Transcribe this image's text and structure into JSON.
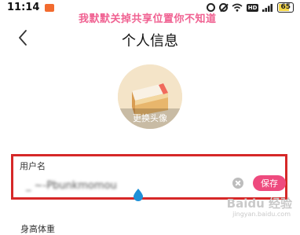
{
  "status_bar": {
    "time": "11:14",
    "battery": "65",
    "notification_icon": "app-notification-icon",
    "icons": [
      "alarm-icon",
      "mute-icon",
      "wifi-icon",
      "hd-icon",
      "signal-icon",
      "battery-icon"
    ]
  },
  "watermark": {
    "top_text": "我默默关掉共享位置你不知道",
    "baidu_logo": "Baidu 经验",
    "baidu_url": "jingyan.baidu.com"
  },
  "nav": {
    "back_icon": "chevron-left-icon",
    "title": "个人信息"
  },
  "avatar": {
    "change_label": "更换头像"
  },
  "username_field": {
    "label": "用户名",
    "value": "_ ~-Pbunkmomou",
    "save_label": "保存",
    "clear_icon": "clear-icon"
  },
  "next_section": {
    "label": "身高体重"
  },
  "colors": {
    "accent": "#ee4a7e",
    "highlight_box": "#d62828",
    "watermark": "#f06292"
  }
}
